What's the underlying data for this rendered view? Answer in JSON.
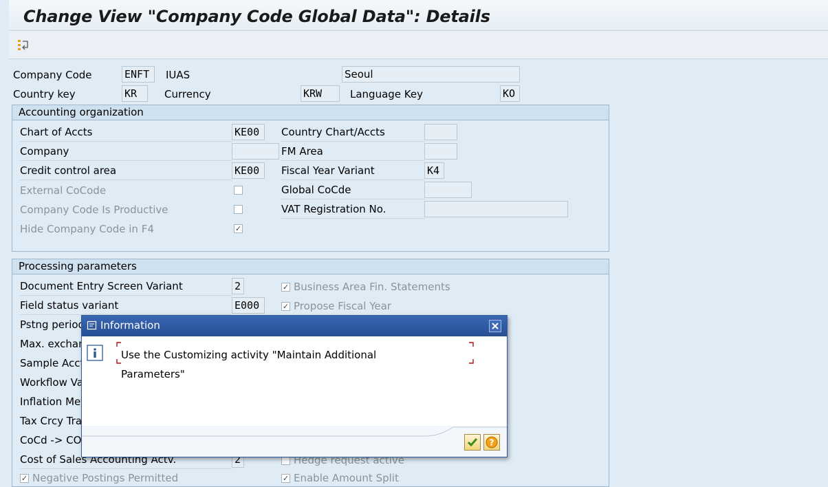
{
  "header": {
    "title": "Change View \"Company Code Global Data\": Details"
  },
  "toolbar": {
    "icon": "details-toggle-icon"
  },
  "top": {
    "company_code_label": "Company Code",
    "company_code_value": "ENFT",
    "company_name": "IUAS",
    "city": "Seoul",
    "country_key_label": "Country key",
    "country_key_value": "KR",
    "currency_label": "Currency",
    "currency_value": "KRW",
    "language_key_label": "Language Key",
    "language_key_value": "KO"
  },
  "accounting": {
    "title": "Accounting organization",
    "chart_of_accts_label": "Chart of Accts",
    "chart_of_accts_value": "KE00",
    "company_label": "Company",
    "company_value": "",
    "credit_control_label": "Credit control area",
    "credit_control_value": "KE00",
    "external_cocode_label": "External CoCode",
    "productive_label": "Company Code Is Productive",
    "hide_f4_label": "Hide Company Code in F4",
    "country_chart_label": "Country Chart/Accts",
    "country_chart_value": "",
    "fm_area_label": "FM Area",
    "fm_area_value": "",
    "fiscal_year_variant_label": "Fiscal Year Variant",
    "fiscal_year_variant_value": "K4",
    "global_cocde_label": "Global CoCde",
    "global_cocde_value": "",
    "vat_label": "VAT Registration No.",
    "vat_value": "",
    "external_cocode_checked": false,
    "productive_checked": false,
    "hide_f4_checked": true
  },
  "processing": {
    "title": "Processing parameters",
    "doc_entry_label": "Document Entry Screen Variant",
    "doc_entry_value": "2",
    "field_status_label": "Field status variant",
    "field_status_value": "E000",
    "pstng_period_label": "Pstng period",
    "max_exchan_label": "Max. exchan",
    "sample_acct_label": "Sample Acct",
    "workflow_label": "Workflow Va",
    "inflation_label": "Inflation Met",
    "tax_crcy_label": "Tax Crcy Tra",
    "cocd_co_label": "CoCd -> CO",
    "cost_of_sales_label": "Cost of Sales Accounting Actv.",
    "cost_of_sales_value": "2",
    "negative_postings_label": "Negative Postings Permitted",
    "business_area_label": "Business Area Fin. Statements",
    "propose_fy_label": "Propose Fiscal Year",
    "hedge_label": "Hedge request active",
    "enable_split_label": "Enable Amount Split",
    "business_area_checked": true,
    "propose_fy_checked": true,
    "hedge_checked": false,
    "negative_postings_checked": true,
    "enable_split_checked": true
  },
  "dialog": {
    "title": "Information",
    "message": "Use the Customizing activity \"Maintain Additional Parameters\""
  }
}
